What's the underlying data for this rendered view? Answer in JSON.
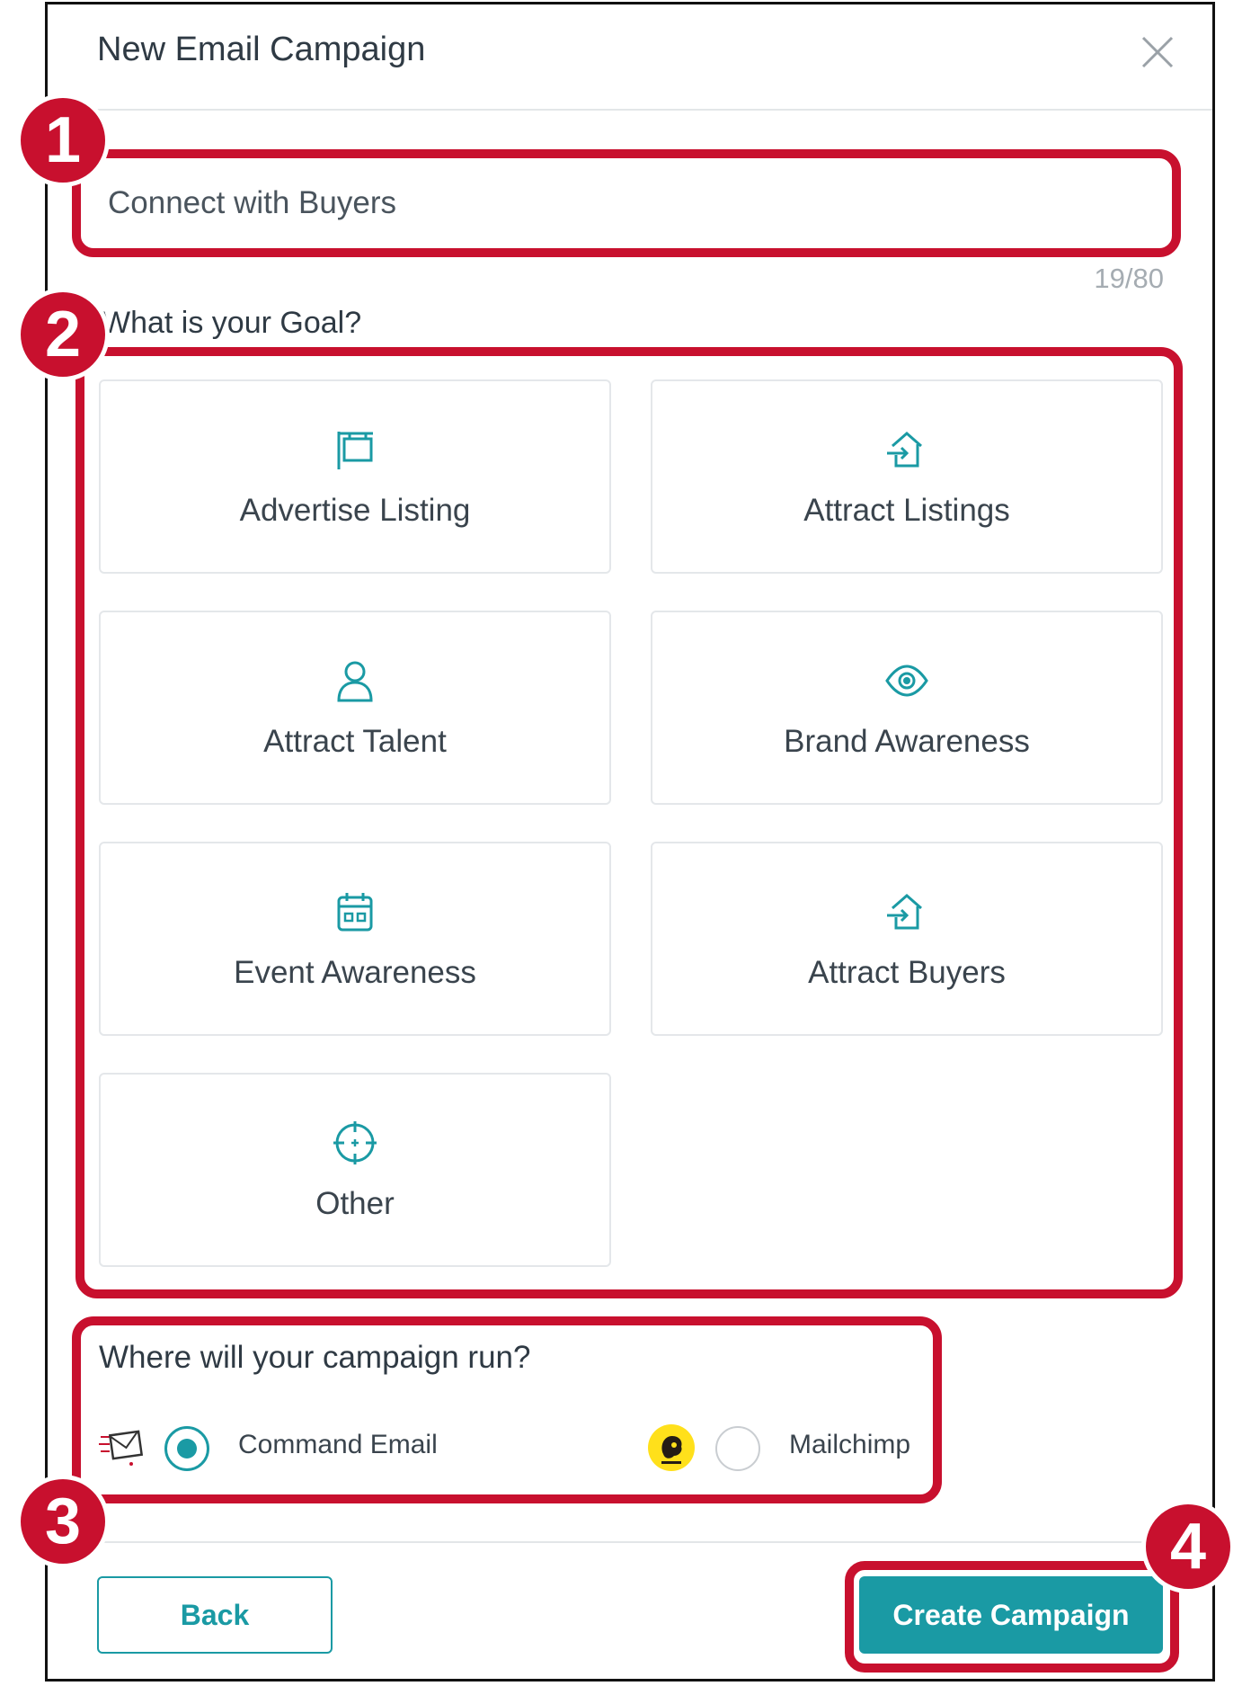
{
  "modal": {
    "title": "New Email Campaign"
  },
  "campaign_name": {
    "value": "Connect with Buyers",
    "counter": "19/80"
  },
  "goal": {
    "label": "What is your Goal?",
    "options": [
      {
        "label": "Advertise Listing",
        "icon": "sign-post-icon"
      },
      {
        "label": "Attract Listings",
        "icon": "house-arrow-icon"
      },
      {
        "label": "Attract Talent",
        "icon": "person-icon"
      },
      {
        "label": "Brand Awareness",
        "icon": "eye-icon"
      },
      {
        "label": "Event Awareness",
        "icon": "calendar-icon"
      },
      {
        "label": "Attract Buyers",
        "icon": "house-arrow-icon"
      },
      {
        "label": "Other",
        "icon": "crosshair-icon"
      }
    ]
  },
  "platform": {
    "label": "Where will your campaign run?",
    "options": [
      {
        "label": "Command Email",
        "selected": true
      },
      {
        "label": "Mailchimp",
        "selected": false
      }
    ]
  },
  "footer": {
    "back_label": "Back",
    "create_label": "Create Campaign"
  },
  "annotations": [
    "1",
    "2",
    "3",
    "4"
  ],
  "colors": {
    "accent": "#1a9aa4",
    "highlight": "#c8102e"
  }
}
